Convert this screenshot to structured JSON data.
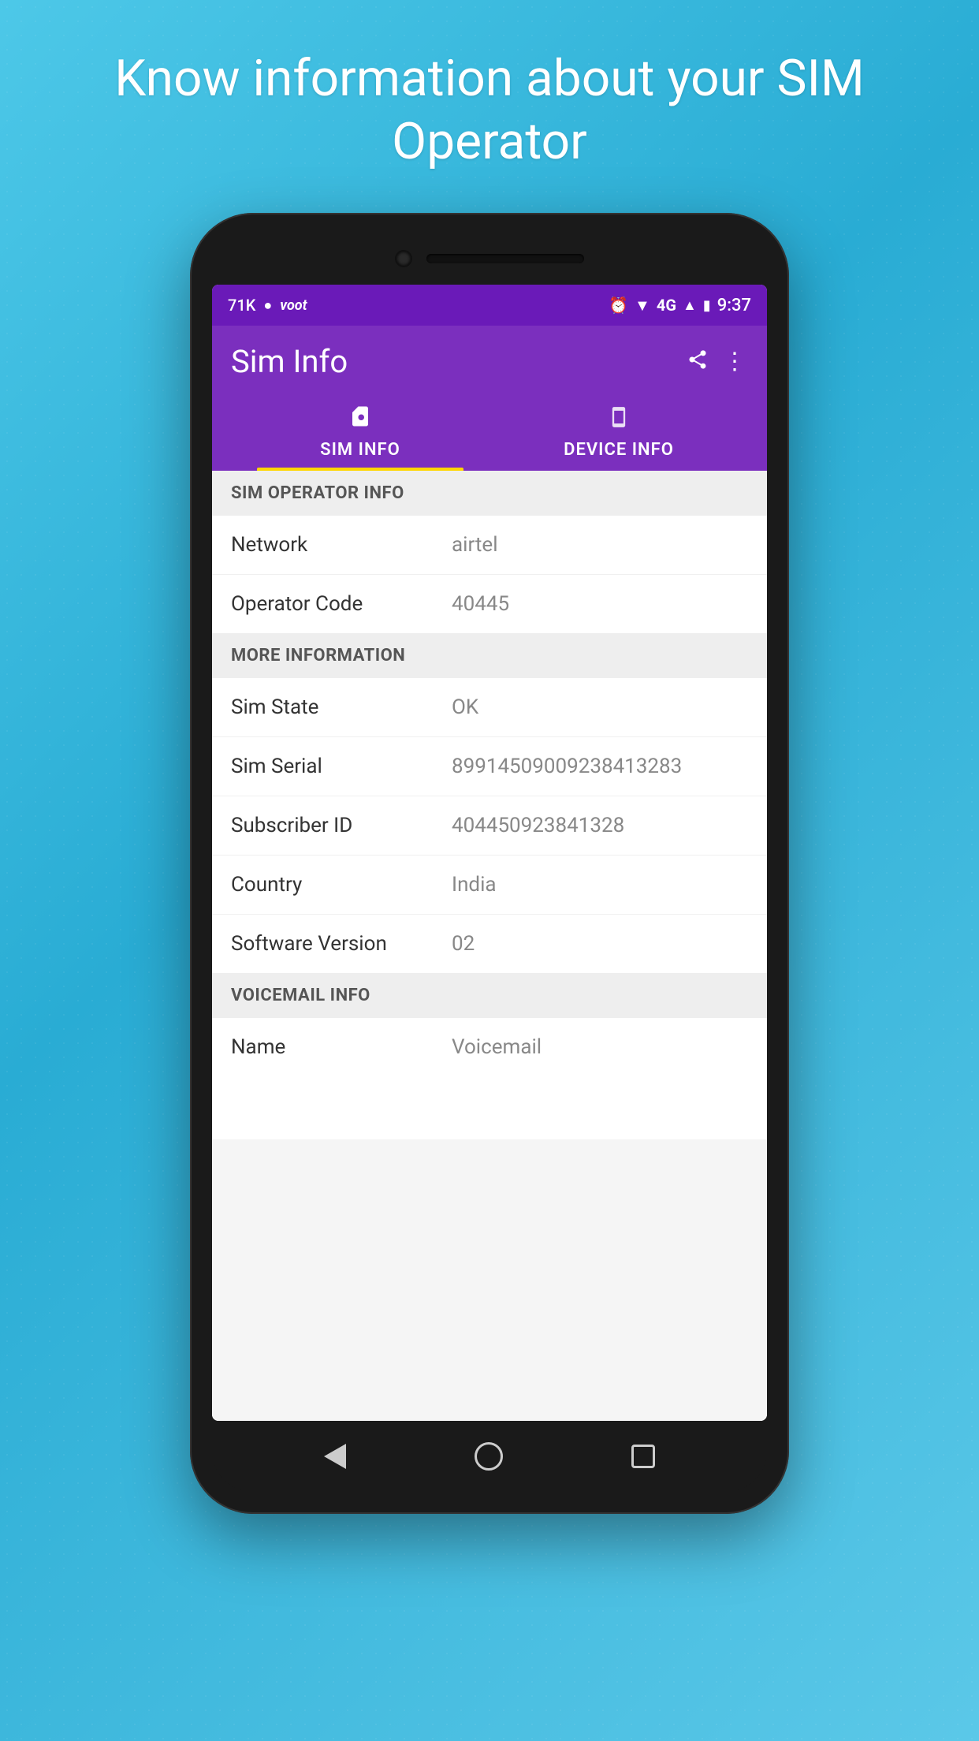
{
  "hero": {
    "title": "Know information about your SIM Operator"
  },
  "status_bar": {
    "left_items": [
      "71K",
      "💬",
      "voot"
    ],
    "right_items": [
      "⏰",
      "📶",
      "4G",
      "🔋",
      "9:37"
    ],
    "time": "9:37"
  },
  "app": {
    "title": "Sim Info"
  },
  "tabs": [
    {
      "id": "sim-info",
      "label": "SIM INFO",
      "icon": "sim",
      "active": true
    },
    {
      "id": "device-info",
      "label": "DEVICE INFO",
      "icon": "phone",
      "active": false
    }
  ],
  "sections": [
    {
      "header": "SIM OPERATOR INFO",
      "rows": [
        {
          "label": "Network",
          "value": "airtel"
        },
        {
          "label": "Operator Code",
          "value": "40445"
        }
      ]
    },
    {
      "header": "MORE INFORMATION",
      "rows": [
        {
          "label": "Sim State",
          "value": "OK"
        },
        {
          "label": "Sim Serial",
          "value": "89914509009238413283"
        },
        {
          "label": "Subscriber ID",
          "value": "404450923841328"
        },
        {
          "label": "Country",
          "value": "India"
        },
        {
          "label": "Software Version",
          "value": "02"
        }
      ]
    },
    {
      "header": "VOICEMAIL INFO",
      "rows": [
        {
          "label": "Name",
          "value": "Voicemail"
        }
      ]
    }
  ]
}
